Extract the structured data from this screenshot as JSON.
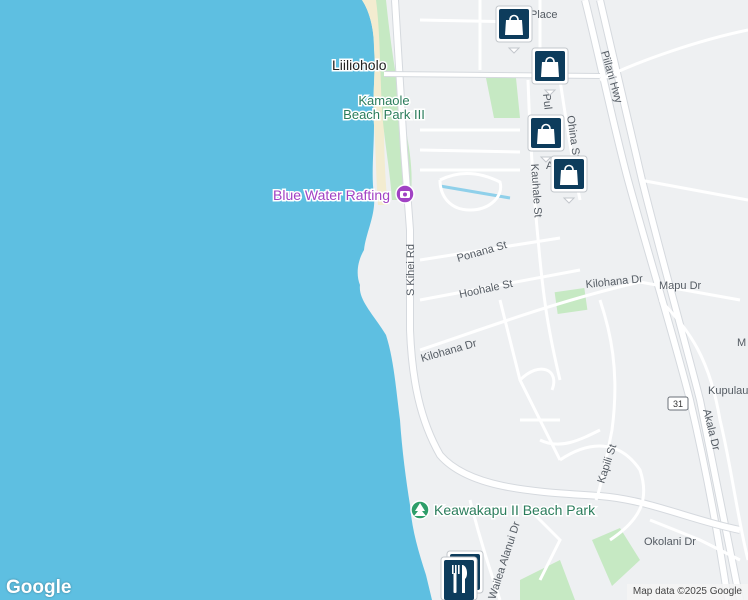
{
  "map": {
    "place_labels": {
      "liilioholo": "Liilioholo",
      "kamaole_line1": "Kamaole",
      "kamaole_line2": "Beach Park III",
      "blue_water": "Blue Water Rafting",
      "keawakapu": "Keawakapu II Beach Park",
      "place_partial": "Place"
    },
    "street_labels": {
      "s_kihei_rd": "S Kihei Rd",
      "piilani_hwy": "Piilani Hwy",
      "kauhale_st": "Kauhale St",
      "ponana_st": "Ponana St",
      "hoohale_st": "Hoohale St",
      "kilohana_dr_west": "Kilohana Dr",
      "kilohana_dr_east": "Kilohana Dr",
      "mapu_dr": "Mapu Dr",
      "kupulau": "Kupulau",
      "akala_dr": "Akala Dr",
      "kapili_st": "Kapili St",
      "okolani_dr": "Okolani Dr",
      "wailea_alanui_dr": "Wailea Alanui Dr",
      "ohina_st": "Ohina St",
      "pul": "Pul",
      "a_st": "A    St",
      "m_partial": "M"
    },
    "route_shield": "31",
    "colors": {
      "water": "#5ebfe1",
      "land": "#eef0f2",
      "park": "#c6e9c3",
      "beach": "#f3ecd0",
      "road": "#ffffff",
      "road_outline": "#d5d9de",
      "shopping_pin": "#0d3c5c",
      "park_marker": "#2e9e69",
      "activity_marker": "#a142c4",
      "place_text": "#2b7d5c",
      "activity_text": "#a142c4"
    }
  },
  "footer": {
    "logo": "Google",
    "attribution": "Map data ©2025 Google"
  }
}
